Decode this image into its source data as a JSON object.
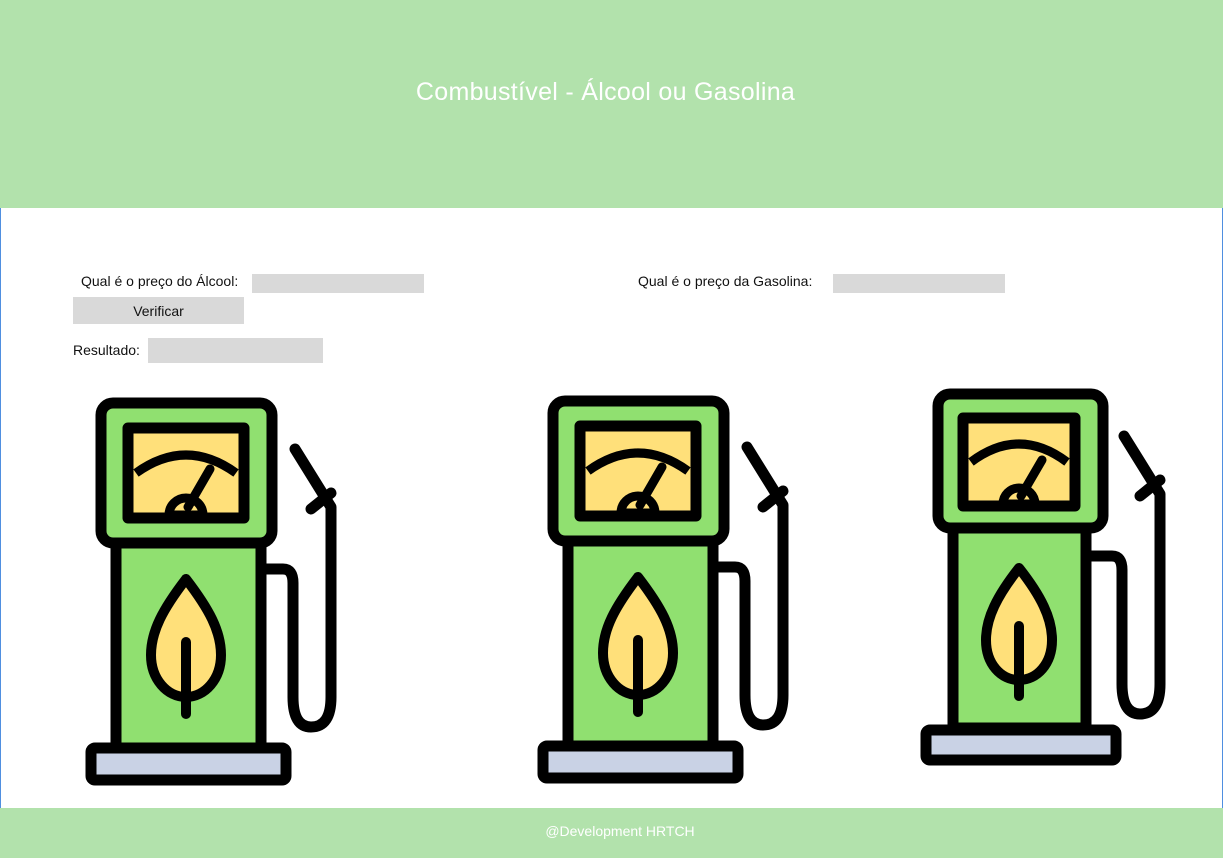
{
  "header": {
    "title": "Combustível - Álcool ou Gasolina"
  },
  "form": {
    "alcool_label": "Qual é o preço do Álcool:",
    "alcool_value": "",
    "gasolina_label": "Qual é o preço da Gasolina:",
    "gasolina_value": "",
    "verify_button_label": "Verificar",
    "result_label": "Resultado:",
    "result_value": ""
  },
  "illustrations": {
    "icon": "fuel-pump-icon",
    "count": 3
  },
  "footer": {
    "text": "@Development HRTCH"
  },
  "colors": {
    "header_bg": "#b2e2ac",
    "footer_bg": "#b2e2ac",
    "input_bg": "#d9d9d9",
    "pump_green": "#90e070",
    "pump_yellow": "#ffe07a",
    "pump_base": "#c9d2e5"
  }
}
